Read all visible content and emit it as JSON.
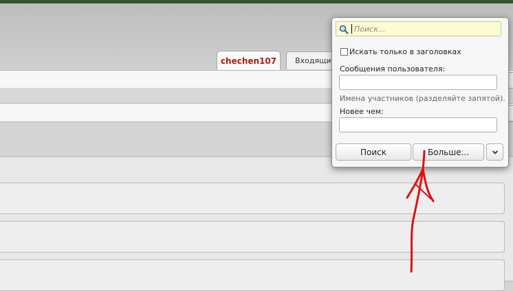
{
  "tabs": {
    "active_label": "chechen107",
    "inbox_label": "Входящие"
  },
  "search_popup": {
    "placeholder": "Поиск...",
    "titles_only_label": "Искать только в заголовках",
    "user_posts_label": "Сообщения пользователя:",
    "user_posts_hint": "Имена участников (разделяйте запятой).",
    "newer_than_label": "Новее чем:",
    "search_button": "Поиск",
    "more_button": "Больше...",
    "dropdown_icon": "chevron-down-icon"
  },
  "colors": {
    "accent_green": "#2f5a2c",
    "active_tab_text": "#a51f15",
    "annotation_arrow": "#e01010"
  }
}
